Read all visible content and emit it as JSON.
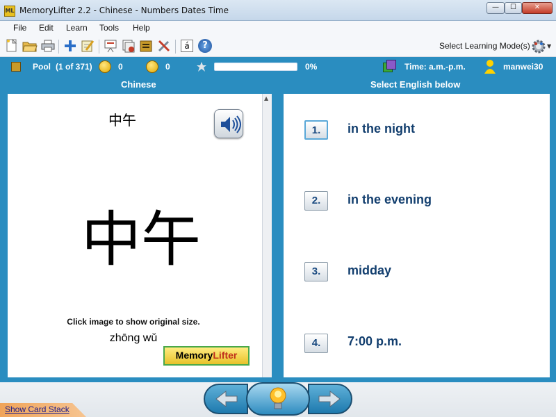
{
  "window": {
    "title": "MemoryLifter 2.2 - Chinese - Numbers Dates Time",
    "app_icon_text": "ML",
    "minimize": "—",
    "maximize": "☐",
    "close": "✕"
  },
  "menu": [
    "File",
    "Edit",
    "Learn",
    "Tools",
    "Help"
  ],
  "toolbar": {
    "mode_label": "Select Learning Mode(s)",
    "icons": [
      "new-document-icon",
      "open-folder-icon",
      "print-icon",
      "add-card-icon",
      "edit-icon",
      "presentation-icon",
      "card-stack-icon",
      "box-icon",
      "tools-icon",
      "character-icon",
      "help-icon",
      "gear-icon"
    ],
    "char_icon_text": "á",
    "help_icon_text": "?"
  },
  "status": {
    "pool_label": "Pool",
    "pool_count": "(1 of 371)",
    "correct_count": "0",
    "wrong_count": "0",
    "progress_fraction": 0,
    "progress_text": "0%",
    "chapter": "Time: a.m.-p.m.",
    "user": "manwei30"
  },
  "question": {
    "header": "Chinese",
    "word_small": "中午",
    "word_large": "中午",
    "caption": "Click image to show original size.",
    "pinyin": "zhōng wǔ",
    "logo_part1": "Memory",
    "logo_part2": "Lifter"
  },
  "answers": {
    "header": "Select English below",
    "items": [
      {
        "num": "1.",
        "text": "in the night"
      },
      {
        "num": "2.",
        "text": "in the evening"
      },
      {
        "num": "3.",
        "text": "midday"
      },
      {
        "num": "4.",
        "text": "7:00 p.m."
      }
    ]
  },
  "bottom": {
    "show_card_stack": "Show Card Stack"
  },
  "colors": {
    "accent": "#2a8dc0",
    "answer_text": "#123e6e"
  }
}
